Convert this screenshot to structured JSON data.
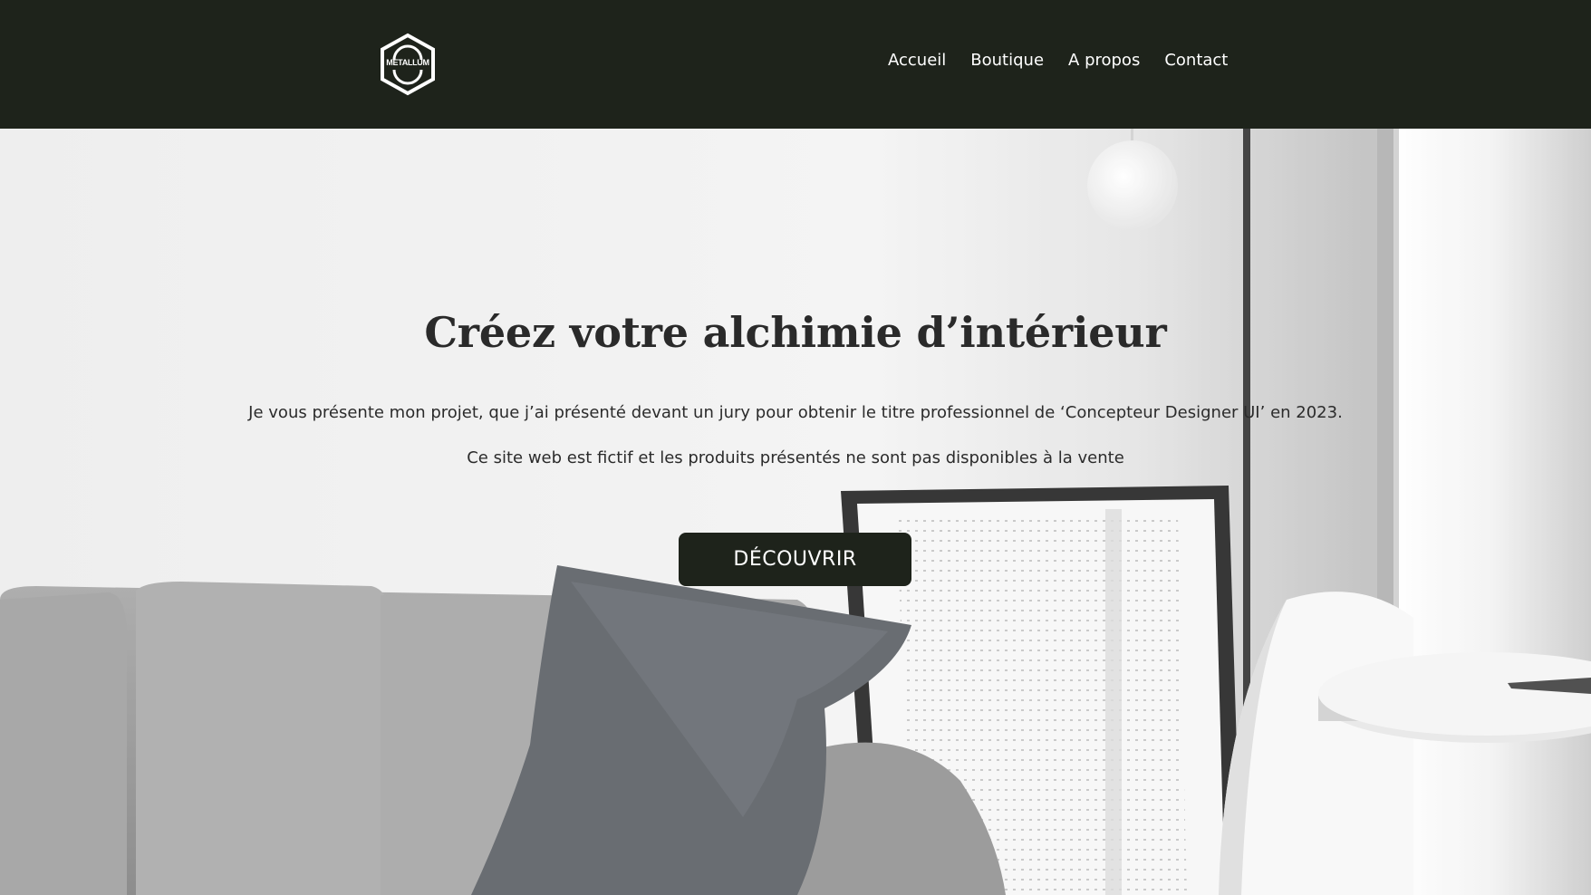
{
  "header": {
    "logo_text": "METALLUM",
    "nav": [
      "Accueil",
      "Boutique",
      "A propos",
      "Contact"
    ]
  },
  "hero": {
    "title": "Créez votre alchimie d’intérieur",
    "paragraph_1": "Je vous présente mon projet, que j’ai présenté devant un jury pour obtenir le titre professionnel de ‘Concepteur Designer UI’ en 2023.",
    "paragraph_2": "Ce site web est fictif et les produits présentés ne sont pas disponibles à la vente",
    "button_label": "DÉCOUVRIR"
  },
  "colors": {
    "header_bg": "#1e231b",
    "button_bg": "#1e231b",
    "text_dark": "#2a2a2a"
  }
}
